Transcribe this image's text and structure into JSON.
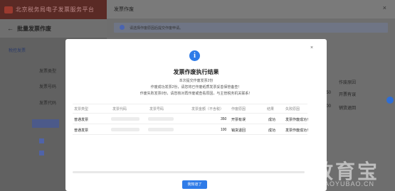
{
  "background": {
    "app_title": "北京税务局电子发票服务平台",
    "page_title": "批量发票作废",
    "back_arrow": "←",
    "tab": "税控发票",
    "side_labels": [
      "发票类型",
      "发票号码",
      "发票代码"
    ],
    "drawer_title": "发票作废",
    "drawer_notice": "请选择作废原因后提交作废申请。",
    "right_values": [
      "350",
      "100"
    ],
    "right_reasons": [
      "开票有误",
      "销货退回"
    ],
    "right_col_header": "作废原因"
  },
  "modal": {
    "close_icon": "×",
    "info_icon_glyph": "i",
    "title": "发票作废执行结果",
    "lines": [
      "本次提交作废发票2份",
      "作废成功发票2份，请您将已作废纸质发票妥善保管备查！",
      "作废失败发票0份，请您核对再作废或查看原因，与主管税务机关联系！"
    ],
    "table": {
      "headers": [
        "发票类型",
        "发票代码",
        "发票号码",
        "发票金额（不含税）",
        "作废原因",
        "结果",
        "失败原因"
      ],
      "rows": [
        {
          "type": "普通发票",
          "amount": "350",
          "reason": "开票有误",
          "result": "成功",
          "detail": "发票作废成功！"
        },
        {
          "type": "普通发票",
          "amount": "100",
          "reason": "销货退回",
          "result": "成功",
          "detail": "发票作废成功！"
        }
      ]
    },
    "ok_button": "我知道了"
  },
  "watermark": {
    "big": "教育宝",
    "small": "JIAOYUBAO.CN"
  },
  "colors": {
    "accent": "#2e7be8",
    "overlay": "#6b6b6b"
  }
}
